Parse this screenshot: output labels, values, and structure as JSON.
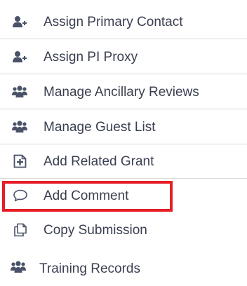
{
  "menu": {
    "items": [
      {
        "label": "Assign Primary Contact",
        "icon": "user-plus-icon"
      },
      {
        "label": "Assign PI Proxy",
        "icon": "user-plus-icon"
      },
      {
        "label": "Manage Ancillary Reviews",
        "icon": "users-icon"
      },
      {
        "label": "Manage Guest List",
        "icon": "users-icon"
      },
      {
        "label": "Add Related Grant",
        "icon": "document-plus-icon"
      },
      {
        "label": "Add Comment",
        "icon": "comment-icon"
      },
      {
        "label": "Copy Submission",
        "icon": "copy-icon"
      },
      {
        "label": "Training Records",
        "icon": "users-icon"
      }
    ],
    "highlighted_item": "Add Comment",
    "highlight_color": "#e61e25",
    "text_color": "#3a3f51",
    "icon_color": "#4a5268"
  }
}
